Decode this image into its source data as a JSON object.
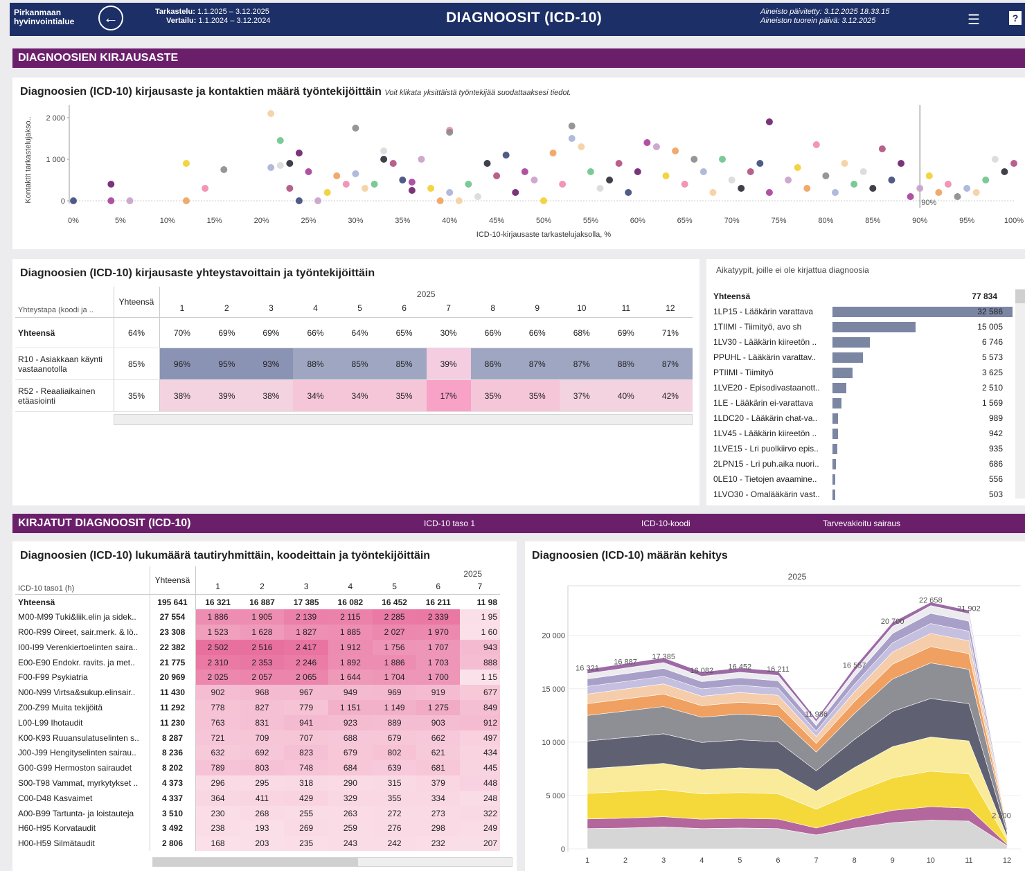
{
  "header": {
    "org_line1": "Pirkanmaan",
    "org_line2": "hyvinvointialue",
    "period_label": "Tarkastelu:",
    "period_value": "1.1.2025 – 3.12.2025",
    "compare_label": "Vertailu:",
    "compare_value": "1.1.2024 – 3.12.2024",
    "title": "DIAGNOOSIT (ICD-10)",
    "updated": "Aineisto päivitetty: 3.12.2025 18.33.15",
    "freshest": "Aineiston tuorein päivä: 3.12.2025",
    "help": "?"
  },
  "section1": {
    "title": "DIAGNOOSIEN KIRJAUSASTE"
  },
  "scatter": {
    "title": "Diagnoosien (ICD-10) kirjausaste ja kontaktien määrä työntekijöittäin",
    "note": "Voit klikata yksittäistä työntekijää suodattaaksesi tiedot.",
    "ylabel": "Kontaktit tarkastelujakso..",
    "xlabel": "ICD-10-kirjausaste tarkastelujaksolla, %",
    "ref_label": "90%",
    "colors": [
      "#3d4a7a",
      "#6b1f6b",
      "#a63f9a",
      "#c9a0c9",
      "#f2cf2e",
      "#f0a15e",
      "#ef8bb0",
      "#8b8b8b",
      "#a8b3d6",
      "#f5cfa0",
      "#6cc48c",
      "#d9d9d9",
      "#2b2b3a",
      "#b05080"
    ]
  },
  "chart_data": [
    {
      "type": "scatter",
      "title": "Diagnoosien (ICD-10) kirjausaste ja kontaktien määrä työntekijöittäin",
      "xlabel": "ICD-10-kirjausaste tarkastelujaksolla, %",
      "ylabel": "Kontaktit tarkastelujakso..",
      "xlim": [
        0,
        100
      ],
      "ylim": [
        0,
        2300
      ],
      "x_ticks": [
        "0%",
        "5%",
        "10%",
        "15%",
        "20%",
        "25%",
        "30%",
        "35%",
        "40%",
        "45%",
        "50%",
        "55%",
        "60%",
        "65%",
        "70%",
        "75%",
        "80%",
        "85%",
        "90%",
        "95%",
        "100%"
      ],
      "y_ticks": [
        "0",
        "1 000",
        "2 000"
      ],
      "reference_line_x": 90,
      "points": [
        [
          0,
          0
        ],
        [
          4,
          400
        ],
        [
          4,
          0
        ],
        [
          6,
          0
        ],
        [
          12,
          900
        ],
        [
          12,
          0
        ],
        [
          14,
          300
        ],
        [
          16,
          750
        ],
        [
          21,
          800
        ],
        [
          21,
          2100
        ],
        [
          22,
          1450
        ],
        [
          22,
          850
        ],
        [
          23,
          900
        ],
        [
          23,
          300
        ],
        [
          24,
          0
        ],
        [
          24,
          1150
        ],
        [
          25,
          700
        ],
        [
          26,
          0
        ],
        [
          27,
          200
        ],
        [
          28,
          600
        ],
        [
          29,
          400
        ],
        [
          30,
          1750
        ],
        [
          30,
          650
        ],
        [
          31,
          300
        ],
        [
          32,
          400
        ],
        [
          33,
          1200
        ],
        [
          33,
          1000
        ],
        [
          34,
          900
        ],
        [
          35,
          500
        ],
        [
          36,
          250
        ],
        [
          36,
          450
        ],
        [
          37,
          1000
        ],
        [
          38,
          300
        ],
        [
          39,
          0
        ],
        [
          40,
          1700
        ],
        [
          40,
          1650
        ],
        [
          40,
          200
        ],
        [
          41,
          0
        ],
        [
          42,
          400
        ],
        [
          43,
          100
        ],
        [
          44,
          900
        ],
        [
          45,
          600
        ],
        [
          46,
          1100
        ],
        [
          47,
          200
        ],
        [
          48,
          700
        ],
        [
          49,
          500
        ],
        [
          50,
          0
        ],
        [
          51,
          1150
        ],
        [
          52,
          400
        ],
        [
          53,
          1800
        ],
        [
          53,
          1500
        ],
        [
          54,
          1300
        ],
        [
          55,
          700
        ],
        [
          56,
          300
        ],
        [
          57,
          500
        ],
        [
          58,
          900
        ],
        [
          59,
          200
        ],
        [
          60,
          700
        ],
        [
          61,
          1400
        ],
        [
          62,
          1300
        ],
        [
          63,
          600
        ],
        [
          64,
          1200
        ],
        [
          65,
          400
        ],
        [
          66,
          1000
        ],
        [
          67,
          700
        ],
        [
          68,
          200
        ],
        [
          69,
          1000
        ],
        [
          70,
          500
        ],
        [
          71,
          300
        ],
        [
          72,
          700
        ],
        [
          73,
          900
        ],
        [
          74,
          1900
        ],
        [
          74,
          200
        ],
        [
          76,
          500
        ],
        [
          77,
          800
        ],
        [
          78,
          300
        ],
        [
          79,
          1350
        ],
        [
          80,
          600
        ],
        [
          81,
          200
        ],
        [
          82,
          900
        ],
        [
          83,
          400
        ],
        [
          84,
          700
        ],
        [
          85,
          300
        ],
        [
          86,
          1250
        ],
        [
          87,
          500
        ],
        [
          88,
          900
        ],
        [
          89,
          100
        ],
        [
          90,
          300
        ],
        [
          91,
          600
        ],
        [
          92,
          200
        ],
        [
          93,
          400
        ],
        [
          94,
          100
        ],
        [
          95,
          300
        ],
        [
          96,
          200
        ],
        [
          97,
          500
        ],
        [
          98,
          1000
        ],
        [
          99,
          700
        ],
        [
          100,
          900
        ]
      ]
    },
    {
      "type": "bar",
      "title": "Aikatyypit, joille ei ole kirjattua diagnoosia",
      "total_label": "Yhteensä",
      "total": 77834,
      "categories": [
        "1LP15 - Lääkärin varattava",
        "1TIIMI - Tiimityö, avo sh",
        "1LV30 - Lääkärin kiireetön ..",
        "PPUHL - Lääkärin varattav..",
        "PTIIMI - Tiimityö",
        "1LVE20 - Episodivastaanott..",
        "1LE - Lääkärin ei-varattava",
        "1LDC20 - Lääkärin chat-va..",
        "1LV45 - Lääkärin kiireetön ..",
        "1LVE15 - Lri puolkiirvo epis..",
        "2LPN15 - Lri puh.aika nuori..",
        "0LE10 - Tietojen avaamine..",
        "1LVO30 - Omalääkärin vast.."
      ],
      "values": [
        32586,
        15005,
        6746,
        5573,
        3625,
        2510,
        1569,
        989,
        942,
        935,
        686,
        556,
        503
      ]
    },
    {
      "type": "area",
      "title": "Diagnoosien (ICD-10) määrän kehitys",
      "year": "2025",
      "categories": [
        "1",
        "2",
        "3",
        "4",
        "5",
        "6",
        "7",
        "8",
        "9",
        "10",
        "11",
        "12"
      ],
      "totals": [
        16321,
        16887,
        17385,
        16082,
        16452,
        16211,
        11986,
        16557,
        20700,
        22658,
        21902,
        2500
      ],
      "total_labels": [
        "16 321",
        "16 887",
        "17 385",
        "16 082",
        "16 452",
        "16 211",
        "11 986",
        "16 557",
        "20 700",
        "22 658",
        "21 902",
        "2 500"
      ],
      "ylim": [
        0,
        24000
      ],
      "y_ticks": [
        "0",
        "5 000",
        "10 000",
        "15 000",
        "20 000"
      ],
      "series": [
        {
          "values": [
            1900,
            1950,
            2050,
            1900,
            1950,
            1900,
            1300,
            1950,
            2450,
            2700,
            2600,
            300
          ],
          "color": "#d6d6d6"
        },
        {
          "values": [
            900,
            930,
            960,
            880,
            900,
            890,
            650,
            900,
            1150,
            1250,
            1200,
            140
          ],
          "color": "#b4679c"
        },
        {
          "values": [
            2400,
            2480,
            2550,
            2360,
            2420,
            2380,
            1760,
            2430,
            3050,
            3330,
            3220,
            370
          ],
          "color": "#f5d93a"
        },
        {
          "values": [
            2300,
            2380,
            2450,
            2270,
            2320,
            2280,
            1690,
            2330,
            2920,
            3200,
            3090,
            350
          ],
          "color": "#f9eb9a"
        },
        {
          "values": [
            2600,
            2690,
            2770,
            2560,
            2620,
            2580,
            1910,
            2640,
            3300,
            3610,
            3490,
            400
          ],
          "color": "#5f6172"
        },
        {
          "values": [
            2400,
            2480,
            2550,
            2360,
            2420,
            2380,
            1760,
            2430,
            3040,
            3330,
            3220,
            360
          ],
          "color": "#8e8e95"
        },
        {
          "values": [
            1100,
            1140,
            1170,
            1080,
            1110,
            1090,
            800,
            1110,
            1390,
            1520,
            1470,
            170
          ],
          "color": "#f0a060"
        },
        {
          "values": [
            900,
            930,
            960,
            890,
            910,
            890,
            660,
            910,
            1140,
            1240,
            1200,
            140
          ],
          "color": "#f5cdaa"
        },
        {
          "values": [
            721,
            709,
            707,
            688,
            679,
            662,
            497,
            700,
            860,
            928,
            900,
            120
          ],
          "color": "#c5bfe0"
        },
        {
          "values": [
            700,
            720,
            740,
            680,
            700,
            690,
            520,
            700,
            880,
            960,
            940,
            80
          ],
          "color": "#a8a0c8"
        },
        {
          "values": [
            500,
            530,
            550,
            500,
            520,
            510,
            370,
            520,
            650,
            720,
            690,
            60
          ],
          "color": "#ececf0"
        },
        {
          "values": [
            400,
            420,
            438,
            404,
            402,
            409,
            249,
            407,
            400,
            320,
            332,
            0
          ],
          "color": "#9d6aa6"
        }
      ]
    }
  ],
  "table_rate": {
    "title": "Diagnoosien (ICD-10) kirjausaste yhteystavoittain ja työntekijöittäin",
    "col_head": "Yhteystapa (koodi ja ..",
    "total_head": "Yhteensä",
    "year": "2025",
    "months": [
      "1",
      "2",
      "3",
      "4",
      "5",
      "6",
      "7",
      "8",
      "9",
      "10",
      "11",
      "12"
    ],
    "rows": [
      {
        "label": "Yhteensä",
        "total": "64%",
        "values": [
          "70%",
          "69%",
          "69%",
          "66%",
          "64%",
          "65%",
          "30%",
          "66%",
          "66%",
          "68%",
          "69%",
          "71%"
        ]
      },
      {
        "label": "R10 - Asiakkaan käynti vastaanotolla",
        "total": "85%",
        "values": [
          "96%",
          "95%",
          "93%",
          "88%",
          "85%",
          "85%",
          "39%",
          "86%",
          "87%",
          "87%",
          "88%",
          "87%"
        ]
      },
      {
        "label": "R52 - Reaaliaikainen etäasiointi",
        "total": "35%",
        "values": [
          "38%",
          "39%",
          "38%",
          "34%",
          "34%",
          "35%",
          "17%",
          "35%",
          "35%",
          "37%",
          "40%",
          "42%"
        ]
      }
    ]
  },
  "aika": {
    "title": "Aikatyypit, joille ei ole kirjattua diagnoosia",
    "total_label": "Yhteensä",
    "total_value": "77 834",
    "rows": [
      {
        "label": "1LP15 - Lääkärin varattava",
        "value": "32 586",
        "num": 32586
      },
      {
        "label": "1TIIMI - Tiimityö, avo sh",
        "value": "15 005",
        "num": 15005
      },
      {
        "label": "1LV30 - Lääkärin kiireetön ..",
        "value": "6 746",
        "num": 6746
      },
      {
        "label": "PPUHL - Lääkärin varattav..",
        "value": "5 573",
        "num": 5573
      },
      {
        "label": "PTIIMI - Tiimityö",
        "value": "3 625",
        "num": 3625
      },
      {
        "label": "1LVE20 - Episodivastaanott..",
        "value": "2 510",
        "num": 2510
      },
      {
        "label": "1LE - Lääkärin ei-varattava",
        "value": "1 569",
        "num": 1569
      },
      {
        "label": "1LDC20 - Lääkärin chat-va..",
        "value": "989",
        "num": 989
      },
      {
        "label": "1LV45 - Lääkärin kiireetön ..",
        "value": "942",
        "num": 942
      },
      {
        "label": "1LVE15 - Lri puolkiirvo epis..",
        "value": "935",
        "num": 935
      },
      {
        "label": "2LPN15 - Lri puh.aika nuori..",
        "value": "686",
        "num": 686
      },
      {
        "label": "0LE10 - Tietojen avaamine..",
        "value": "556",
        "num": 556
      },
      {
        "label": "1LVO30 - Omalääkärin vast..",
        "value": "503",
        "num": 503
      }
    ]
  },
  "section2": {
    "title": "KIRJATUT DIAGNOOSIT (ICD-10)",
    "sel1": "ICD-10 taso 1",
    "sel2": "ICD-10-koodi",
    "sel3": "Tarvevakioitu sairaus"
  },
  "table_diag": {
    "title": "Diagnoosien (ICD-10) lukumäärä tautiryhmittäin, koodeittain ja työntekijöittäin",
    "col_head": "ICD-10 taso1 (h)",
    "total_head": "Yhteensä",
    "year": "2025",
    "months": [
      "1",
      "2",
      "3",
      "4",
      "5",
      "6",
      "7"
    ],
    "rows": [
      {
        "label": "Yhteensä",
        "total": "195 641",
        "values": [
          "16 321",
          "16 887",
          "17 385",
          "16 082",
          "16 452",
          "16 211",
          "11 98"
        ]
      },
      {
        "label": "M00-M99 Tuki&liik.elin ja sidek..",
        "total": "27 554",
        "values": [
          "1 886",
          "1 905",
          "2 139",
          "2 115",
          "2 285",
          "2 339",
          "1 95"
        ]
      },
      {
        "label": "R00-R99 Oireet, sair.merk. & lö..",
        "total": "23 308",
        "values": [
          "1 523",
          "1 628",
          "1 827",
          "1 885",
          "2 027",
          "1 970",
          "1 60"
        ]
      },
      {
        "label": "I00-I99 Verenkiertoelinten saira..",
        "total": "22 382",
        "values": [
          "2 502",
          "2 516",
          "2 417",
          "1 912",
          "1 756",
          "1 707",
          "943"
        ]
      },
      {
        "label": "E00-E90 Endokr. ravits. ja met..",
        "total": "21 775",
        "values": [
          "2 310",
          "2 353",
          "2 246",
          "1 892",
          "1 886",
          "1 703",
          "888"
        ]
      },
      {
        "label": "F00-F99 Psykiatria",
        "total": "20 969",
        "values": [
          "2 025",
          "2 057",
          "2 065",
          "1 644",
          "1 704",
          "1 700",
          "1 15"
        ]
      },
      {
        "label": "N00-N99 Virtsa&sukup.elinsair..",
        "total": "11 430",
        "values": [
          "902",
          "968",
          "967",
          "949",
          "969",
          "919",
          "677"
        ]
      },
      {
        "label": "Z00-Z99 Muita tekijöitä",
        "total": "11 292",
        "values": [
          "778",
          "827",
          "779",
          "1 151",
          "1 149",
          "1 275",
          "849"
        ]
      },
      {
        "label": "L00-L99 Ihotaudit",
        "total": "11 230",
        "values": [
          "763",
          "831",
          "941",
          "923",
          "889",
          "903",
          "912"
        ]
      },
      {
        "label": "K00-K93 Ruuansulatuselinten s..",
        "total": "8 287",
        "values": [
          "721",
          "709",
          "707",
          "688",
          "679",
          "662",
          "497"
        ]
      },
      {
        "label": "J00-J99 Hengityselinten sairau..",
        "total": "8 236",
        "values": [
          "632",
          "692",
          "823",
          "679",
          "802",
          "621",
          "434"
        ]
      },
      {
        "label": "G00-G99 Hermoston sairaudet",
        "total": "8 202",
        "values": [
          "789",
          "803",
          "748",
          "684",
          "639",
          "681",
          "445"
        ]
      },
      {
        "label": "S00-T98 Vammat, myrkytykset ..",
        "total": "4 373",
        "values": [
          "296",
          "295",
          "318",
          "290",
          "315",
          "379",
          "448"
        ]
      },
      {
        "label": "C00-D48 Kasvaimet",
        "total": "4 337",
        "values": [
          "364",
          "411",
          "429",
          "329",
          "355",
          "334",
          "248"
        ]
      },
      {
        "label": "A00-B99 Tartunta- ja loistauteja",
        "total": "3 510",
        "values": [
          "230",
          "268",
          "255",
          "263",
          "272",
          "273",
          "322"
        ]
      },
      {
        "label": "H60-H95 Korvataudit",
        "total": "3 492",
        "values": [
          "238",
          "193",
          "269",
          "259",
          "276",
          "298",
          "249"
        ]
      },
      {
        "label": "H00-H59 Silmätaudit",
        "total": "2 806",
        "values": [
          "168",
          "203",
          "235",
          "243",
          "242",
          "232",
          "207"
        ]
      }
    ]
  },
  "area": {
    "title": "Diagnoosien (ICD-10) määrän kehitys",
    "year": "2025"
  }
}
